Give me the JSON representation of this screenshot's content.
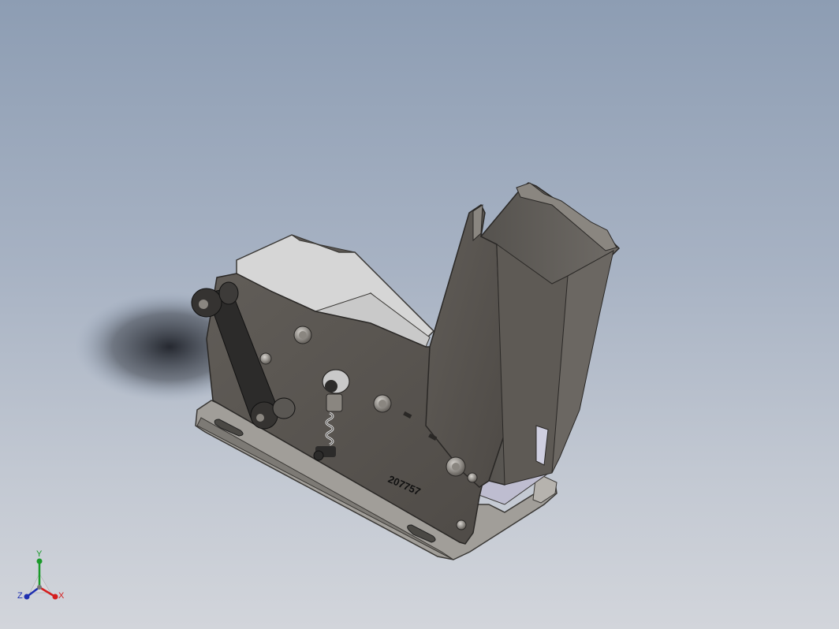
{
  "model": {
    "part_number": "207757"
  },
  "triad": {
    "x_label": "X",
    "y_label": "Y",
    "z_label": "Z",
    "x_color": "#d41e1e",
    "y_color": "#1a9a2a",
    "z_color": "#1e2fb0"
  },
  "colors": {
    "background_top": "#8d9db3",
    "background_bottom": "#d2d5db",
    "plate_dark": "#595551",
    "base_plate": "#a19e99",
    "channel_light": "#d7d7d7",
    "link_dark": "#2c2b2a"
  }
}
